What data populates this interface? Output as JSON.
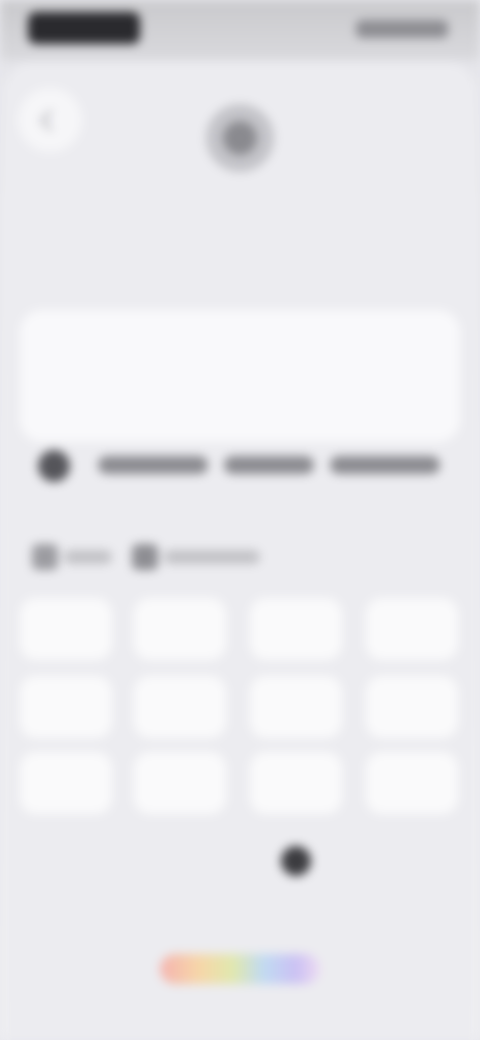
{
  "status_bar": {
    "time": "",
    "icons": [
      "signal-icon",
      "wifi-icon",
      "battery-icon"
    ]
  },
  "header": {
    "contact_name": "",
    "avatar_icon": "person-icon"
  },
  "composer": {
    "placeholder": ""
  },
  "info_row": {
    "icon": "info-icon",
    "text": ""
  },
  "mode_row": {
    "icons": [
      "mode-icon",
      "app-icon"
    ]
  },
  "keypad": {
    "row1": [
      "",
      "",
      "",
      ""
    ],
    "row2": [
      "",
      "",
      "",
      ""
    ],
    "row3": [
      "",
      "",
      "",
      ""
    ],
    "row4": [
      "",
      "",
      "",
      ""
    ]
  },
  "colors": {
    "background": "#ececf0",
    "key": "#fafafb",
    "accent": "#3c3c40"
  }
}
